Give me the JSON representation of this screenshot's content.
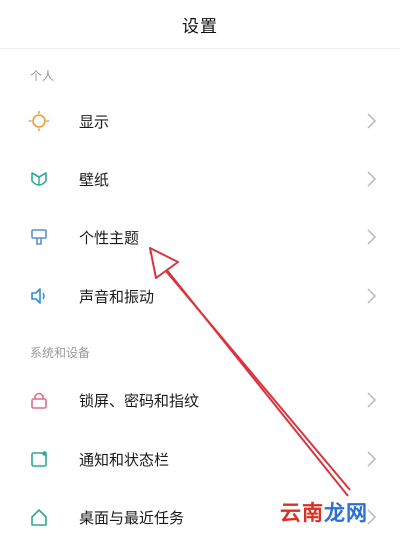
{
  "header": {
    "title": "设置"
  },
  "sections": [
    {
      "label": "个人"
    },
    {
      "label": "系统和设备"
    }
  ],
  "items": [
    {
      "label": "显示",
      "icon": "sun-icon"
    },
    {
      "label": "壁纸",
      "icon": "wallpaper-icon"
    },
    {
      "label": "个性主题",
      "icon": "theme-brush-icon"
    },
    {
      "label": "声音和振动",
      "icon": "speaker-icon"
    },
    {
      "label": "锁屏、密码和指纹",
      "icon": "lock-icon"
    },
    {
      "label": "通知和状态栏",
      "icon": "notification-icon"
    },
    {
      "label": "桌面与最近任务",
      "icon": "home-icon"
    }
  ],
  "watermark": {
    "part1": "云南",
    "part2": "龙网"
  },
  "colors": {
    "icon_orange": "#e8a13a",
    "icon_teal": "#2fa99a",
    "icon_blue": "#5a8fd8",
    "icon_pink": "#e06b8a",
    "arrow_red": "#d9343f",
    "chevron": "#b8b8b8"
  }
}
